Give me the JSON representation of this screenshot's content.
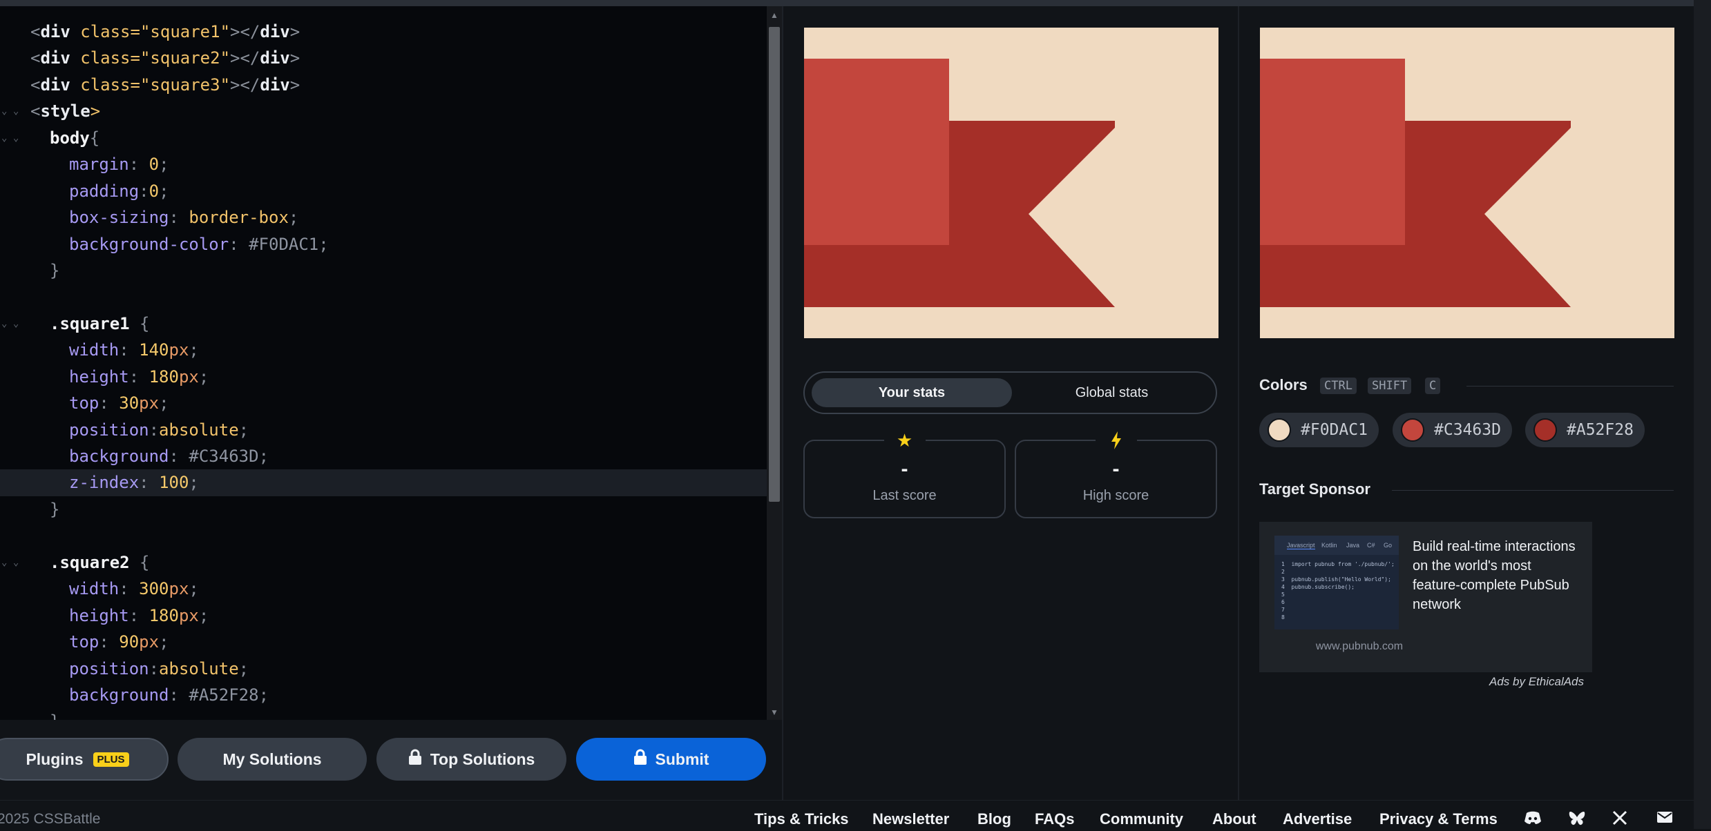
{
  "editor": {
    "lines": [
      [
        "<",
        "div",
        " class=",
        "\"square1\"",
        "></",
        "div",
        ">"
      ],
      [
        "<",
        "div",
        " class=",
        "\"square2\"",
        "></",
        "div",
        ">"
      ],
      [
        "<",
        "div",
        " class=",
        "\"square3\"",
        "></",
        "div",
        ">"
      ],
      [
        "<",
        "style",
        ">"
      ],
      [
        "body",
        "{"
      ],
      [
        "margin",
        ": ",
        "0",
        ";"
      ],
      [
        "padding",
        ":",
        "0",
        ";"
      ],
      [
        "box-sizing",
        ": ",
        "border-box",
        ";"
      ],
      [
        "background-color",
        ": ",
        "#F0DAC1",
        ";"
      ],
      [
        "}"
      ],
      [],
      [
        ".square1",
        " {"
      ],
      [
        "width",
        ": ",
        "140",
        "px",
        ";"
      ],
      [
        "height",
        ": ",
        "180",
        "px",
        ";"
      ],
      [
        "top",
        ": ",
        "30",
        "px",
        ";"
      ],
      [
        "position",
        ":",
        "absolute",
        ";"
      ],
      [
        "background",
        ": ",
        "#C3463D",
        ";"
      ],
      [
        "z-index",
        ": ",
        "100",
        ";"
      ],
      [
        "}"
      ],
      [],
      [
        ".square2",
        " {"
      ],
      [
        "width",
        ": ",
        "300",
        "px",
        ";"
      ],
      [
        "height",
        ": ",
        "180",
        "px",
        ";"
      ],
      [
        "top",
        ": ",
        "90",
        "px",
        ";"
      ],
      [
        "position",
        ":",
        "absolute",
        ";"
      ],
      [
        "background",
        ": ",
        "#A52F28",
        ";"
      ],
      [
        "}"
      ]
    ]
  },
  "actions": {
    "plugins": "Plugins",
    "plus_badge": "PLUS",
    "my_solutions": "My Solutions",
    "top_solutions": "Top Solutions",
    "submit": "Submit"
  },
  "stats": {
    "tab_yours": "Your stats",
    "tab_global": "Global stats",
    "last_score_value": "-",
    "last_score_label": "Last score",
    "high_score_value": "-",
    "high_score_label": "High score",
    "last_icon": "star-icon",
    "high_icon": "lightning-icon"
  },
  "colors": {
    "title": "Colors",
    "shortcut": [
      "CTRL",
      "SHIFT",
      "C"
    ],
    "items": [
      "#F0DAC1",
      "#C3463D",
      "#A52F28"
    ]
  },
  "sponsor": {
    "title": "Target Sponsor",
    "ad_tabs": [
      "Javascript",
      "Kotlin",
      "Java",
      "C#",
      "Go"
    ],
    "ad_code": "1  import pubnub from './pubnub/';\n2\n3  pubnub.publish(\"Hello World\");\n4  pubnub.subscribe();\n5\n6\n7\n8",
    "ad_text": "Build real-time interactions on the world's most feature-complete PubSub network",
    "ad_url": "www.pubnub.com",
    "ads_by": "Ads by EthicalAds"
  },
  "footer": {
    "copyright": "2025 CSSBattle",
    "links": [
      "Tips & Tricks",
      "Newsletter",
      "Blog",
      "FAQs",
      "Community",
      "About",
      "Advertise",
      "Privacy & Terms"
    ],
    "icons": [
      "discord-icon",
      "bluesky-icon",
      "x-icon",
      "mail-icon"
    ]
  },
  "theme": {
    "background": "#111418",
    "accent": "#0a63d8",
    "badge": "#f9d01a"
  }
}
